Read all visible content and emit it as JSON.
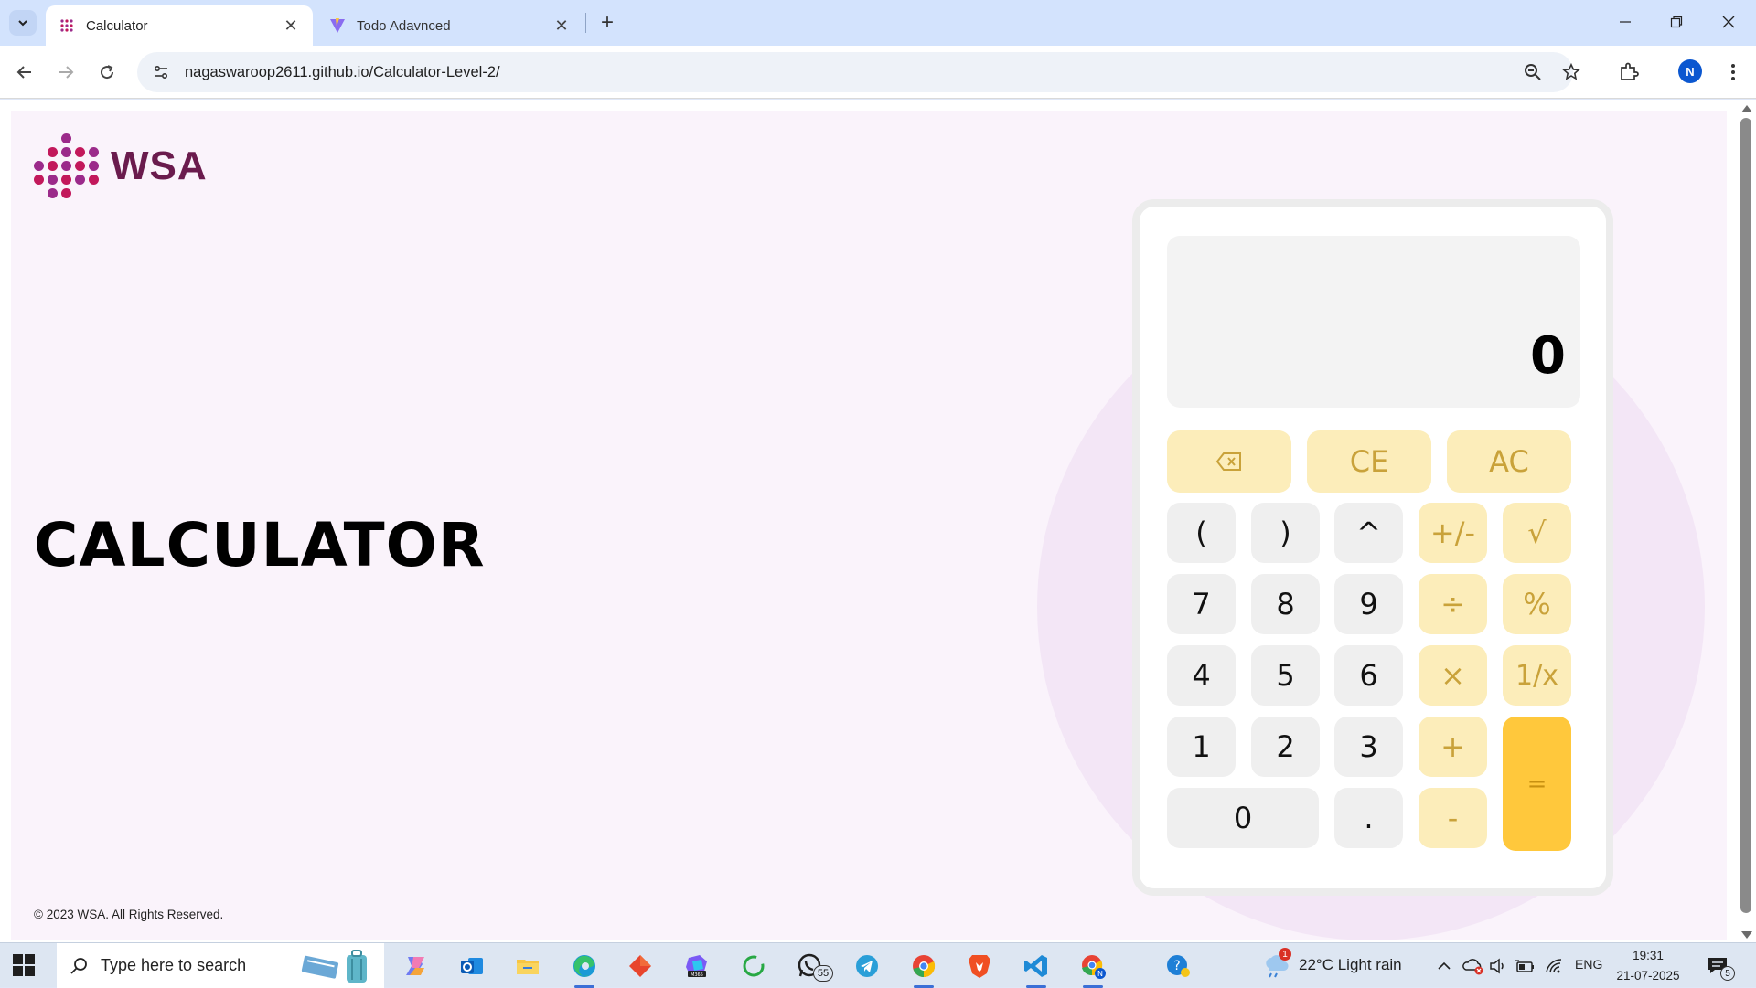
{
  "browser": {
    "tabs": [
      {
        "title": "Calculator",
        "active": true,
        "favicon": "wsa-dots-favicon"
      },
      {
        "title": "Todo Adavnced",
        "active": false,
        "favicon": "vite-favicon"
      }
    ],
    "url": "nagaswaroop2611.github.io/Calculator-Level-2/",
    "profile_initial": "N"
  },
  "page": {
    "logo_text": "WSA",
    "title": "CALCULATOR",
    "footer": "© 2023 WSA. All Rights Reserved."
  },
  "calculator": {
    "display": "0",
    "keys": {
      "backspace": "⌫",
      "ce": "CE",
      "ac": "AC",
      "lparen": "(",
      "rparen": ")",
      "power": "^",
      "negate": "+/-",
      "sqrt": "√",
      "seven": "7",
      "eight": "8",
      "nine": "9",
      "divide": "÷",
      "percent": "%",
      "four": "4",
      "five": "5",
      "six": "6",
      "multiply": "×",
      "reciprocal": "1/x",
      "one": "1",
      "two": "2",
      "three": "3",
      "plus": "+",
      "equals": "=",
      "zero": "0",
      "dot": ".",
      "minus": "-"
    }
  },
  "taskbar": {
    "search_placeholder": "Type here to search",
    "whatsapp_badge": "55",
    "weather": "22°C  Light rain",
    "weather_alert": "1",
    "language": "ENG",
    "time": "19:31",
    "date": "21-07-2025",
    "notifications": "5"
  },
  "colors": {
    "page_bg": "#faf3fb",
    "op_key": "#fcedba",
    "equals_key": "#ffc83c",
    "logo_text": "#6a1b4d"
  }
}
